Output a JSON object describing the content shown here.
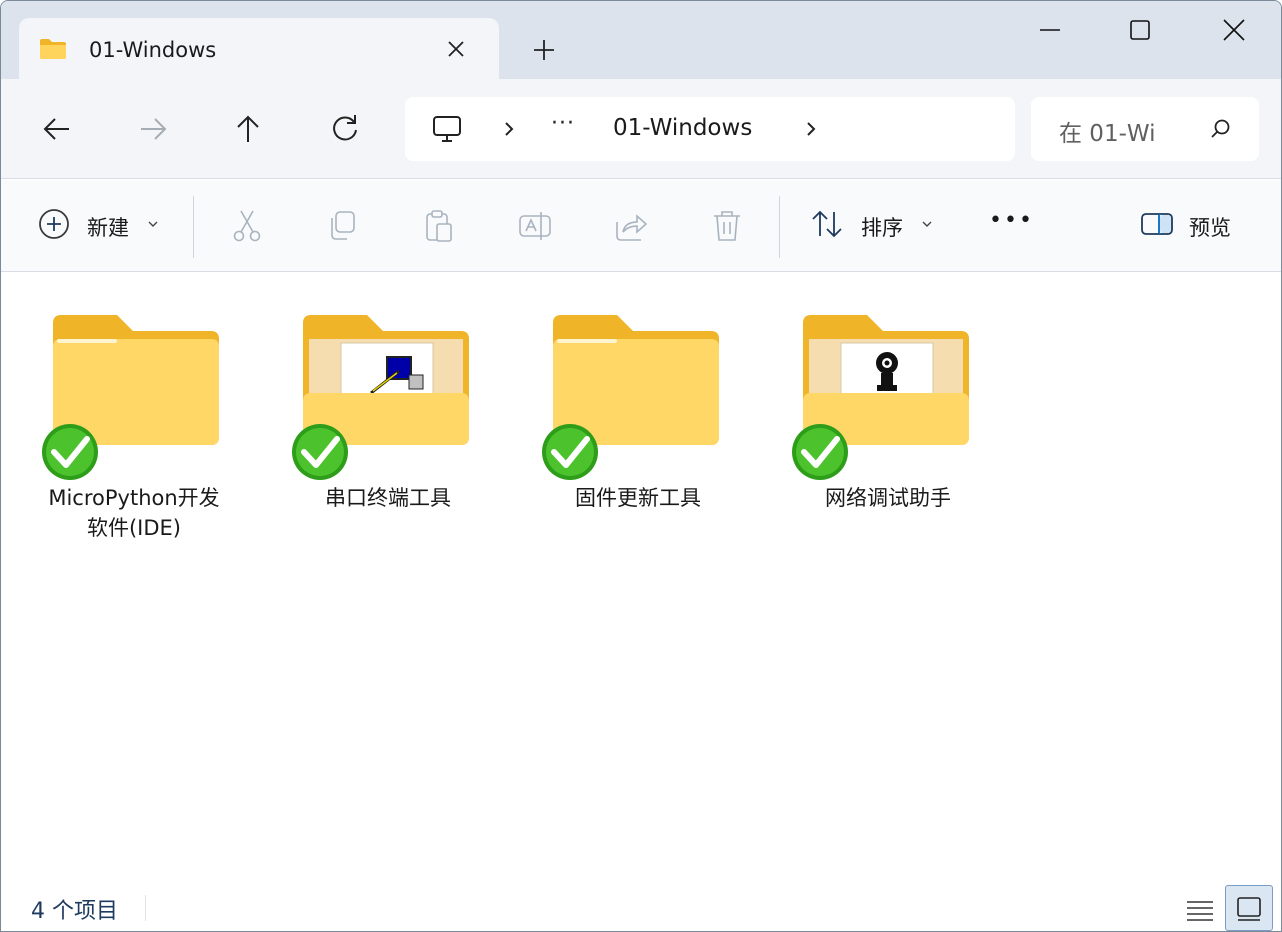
{
  "tab": {
    "title": "01-Windows",
    "icon": "folder-icon"
  },
  "window_controls": [
    "minimize-icon",
    "maximize-icon",
    "close-icon"
  ],
  "nav": {
    "back": "arrow-left-icon",
    "forward": "arrow-right-icon",
    "up": "arrow-up-icon",
    "refresh": "refresh-icon"
  },
  "address": {
    "root_icon": "computer-icon",
    "more": "···",
    "segment": "01-Windows"
  },
  "search": {
    "placeholder": "在 01-Wi"
  },
  "commands": {
    "new_label": "新建",
    "sort_label": "排序",
    "more": "•••",
    "preview_label": "预览"
  },
  "items": [
    {
      "label": "MicroPython开发软件(IDE)",
      "type": "folder-plain"
    },
    {
      "label": "串口终端工具",
      "type": "folder-terminal"
    },
    {
      "label": "固件更新工具",
      "type": "folder-plain"
    },
    {
      "label": "网络调试助手",
      "type": "folder-network"
    }
  ],
  "status": {
    "count_text": "4 个项目"
  },
  "colors": {
    "folder_back": "#f0b429",
    "folder_front": "#ffd766",
    "check_green": "#2e9e1a",
    "accent": "#0067c0"
  }
}
